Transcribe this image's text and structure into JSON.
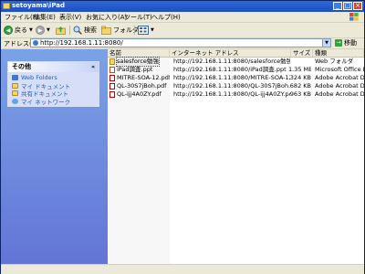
{
  "window": {
    "title": "setoyama\\iPad"
  },
  "menu": [
    "ファイル(F)",
    "編集(E)",
    "表示(V)",
    "お気に入り(A)",
    "ツール(T)",
    "ヘルプ(H)"
  ],
  "toolbar": {
    "back_label": "戻る",
    "search_label": "検索",
    "folders_label": "フォルダ"
  },
  "address": {
    "label": "アドレス(D)",
    "value": "http://192.168.1.11:8080/",
    "go_label": "移動"
  },
  "sidebar": {
    "title": "その他",
    "items": [
      {
        "label": "Web Folders",
        "icon": "web-folders-icon"
      },
      {
        "label": "マイ ドキュメント",
        "icon": "my-documents-icon"
      },
      {
        "label": "共有ドキュメント",
        "icon": "shared-documents-icon"
      },
      {
        "label": "マイ ネットワーク",
        "icon": "my-network-icon"
      }
    ]
  },
  "columns": {
    "name": "名前",
    "address": "インターネット アドレス",
    "size": "サイズ",
    "type": "種類"
  },
  "files": [
    {
      "name": "salesforce勉強",
      "address": "http://192.168.1.11:8080/salesforce勉強",
      "size": "",
      "type": "Web フォルダ",
      "icon": "folder-icon"
    },
    {
      "name": "iPad調査.ppt",
      "address": "http://192.168.1.11:8080/iPad調査.ppt",
      "size": "1.35 MB",
      "type": "Microsoft Office Po...",
      "icon": "ppt-icon"
    },
    {
      "name": "MITRE-SOA-12.pdf",
      "address": "http://192.168.1.11:8080/MITRE-SOA-12.pdf",
      "size": "324 KB",
      "type": "Adobe Acrobat Doc...",
      "icon": "pdf-icon"
    },
    {
      "name": "QL-30S7jBoh.pdf",
      "address": "http://192.168.1.11:8080/QL-30S7jBoh.pdf",
      "size": "682 KB",
      "type": "Adobe Acrobat Doc...",
      "icon": "pdf-icon"
    },
    {
      "name": "QL-ijj4A0ZY.pdf",
      "address": "http://192.168.1.11:8080/QL-ijj4A0ZY.pdf",
      "size": "963 KB",
      "type": "Adobe Acrobat Doc...",
      "icon": "pdf-icon"
    }
  ]
}
